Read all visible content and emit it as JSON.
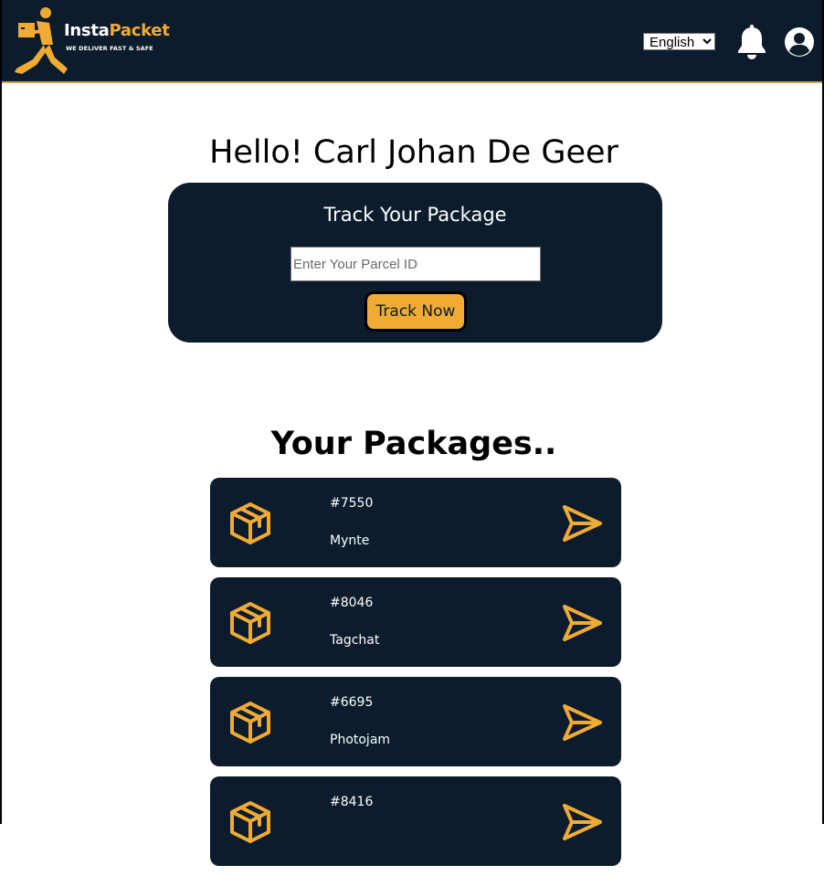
{
  "header": {
    "logo_name_part1": "Insta",
    "logo_name_part2": "Packet",
    "logo_tagline": "WE DELIVER FAST & SAFE",
    "language": "English",
    "language_options": [
      "English"
    ],
    "icons": {
      "notifications": "bell-icon",
      "profile": "user-circle-icon"
    }
  },
  "greeting": "Hello! Carl Johan De Geer",
  "track": {
    "title": "Track Your Package",
    "input_placeholder": "Enter Your Parcel ID",
    "input_value": "",
    "button_label": "Track Now"
  },
  "packages": {
    "title": "Your Packages..",
    "items": [
      {
        "id": "#7550",
        "name": "Mynte"
      },
      {
        "id": "#8046",
        "name": "Tagchat"
      },
      {
        "id": "#6695",
        "name": "Photojam"
      },
      {
        "id": "#8416",
        "name": ""
      }
    ]
  },
  "colors": {
    "navy": "#0c1c2c",
    "accent": "#f0ab35",
    "white": "#ffffff"
  }
}
